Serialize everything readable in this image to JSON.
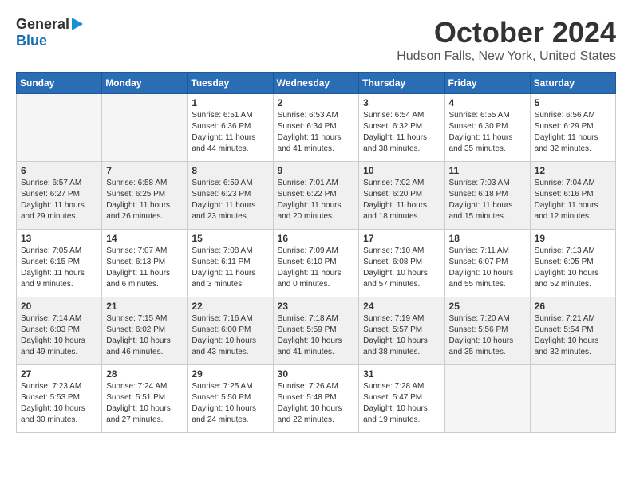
{
  "logo": {
    "general": "General",
    "blue": "Blue"
  },
  "title": "October 2024",
  "location": "Hudson Falls, New York, United States",
  "days_of_week": [
    "Sunday",
    "Monday",
    "Tuesday",
    "Wednesday",
    "Thursday",
    "Friday",
    "Saturday"
  ],
  "weeks": [
    [
      {
        "day": "",
        "sunrise": "",
        "sunset": "",
        "daylight": ""
      },
      {
        "day": "",
        "sunrise": "",
        "sunset": "",
        "daylight": ""
      },
      {
        "day": "1",
        "sunrise": "Sunrise: 6:51 AM",
        "sunset": "Sunset: 6:36 PM",
        "daylight": "Daylight: 11 hours and 44 minutes."
      },
      {
        "day": "2",
        "sunrise": "Sunrise: 6:53 AM",
        "sunset": "Sunset: 6:34 PM",
        "daylight": "Daylight: 11 hours and 41 minutes."
      },
      {
        "day": "3",
        "sunrise": "Sunrise: 6:54 AM",
        "sunset": "Sunset: 6:32 PM",
        "daylight": "Daylight: 11 hours and 38 minutes."
      },
      {
        "day": "4",
        "sunrise": "Sunrise: 6:55 AM",
        "sunset": "Sunset: 6:30 PM",
        "daylight": "Daylight: 11 hours and 35 minutes."
      },
      {
        "day": "5",
        "sunrise": "Sunrise: 6:56 AM",
        "sunset": "Sunset: 6:29 PM",
        "daylight": "Daylight: 11 hours and 32 minutes."
      }
    ],
    [
      {
        "day": "6",
        "sunrise": "Sunrise: 6:57 AM",
        "sunset": "Sunset: 6:27 PM",
        "daylight": "Daylight: 11 hours and 29 minutes."
      },
      {
        "day": "7",
        "sunrise": "Sunrise: 6:58 AM",
        "sunset": "Sunset: 6:25 PM",
        "daylight": "Daylight: 11 hours and 26 minutes."
      },
      {
        "day": "8",
        "sunrise": "Sunrise: 6:59 AM",
        "sunset": "Sunset: 6:23 PM",
        "daylight": "Daylight: 11 hours and 23 minutes."
      },
      {
        "day": "9",
        "sunrise": "Sunrise: 7:01 AM",
        "sunset": "Sunset: 6:22 PM",
        "daylight": "Daylight: 11 hours and 20 minutes."
      },
      {
        "day": "10",
        "sunrise": "Sunrise: 7:02 AM",
        "sunset": "Sunset: 6:20 PM",
        "daylight": "Daylight: 11 hours and 18 minutes."
      },
      {
        "day": "11",
        "sunrise": "Sunrise: 7:03 AM",
        "sunset": "Sunset: 6:18 PM",
        "daylight": "Daylight: 11 hours and 15 minutes."
      },
      {
        "day": "12",
        "sunrise": "Sunrise: 7:04 AM",
        "sunset": "Sunset: 6:16 PM",
        "daylight": "Daylight: 11 hours and 12 minutes."
      }
    ],
    [
      {
        "day": "13",
        "sunrise": "Sunrise: 7:05 AM",
        "sunset": "Sunset: 6:15 PM",
        "daylight": "Daylight: 11 hours and 9 minutes."
      },
      {
        "day": "14",
        "sunrise": "Sunrise: 7:07 AM",
        "sunset": "Sunset: 6:13 PM",
        "daylight": "Daylight: 11 hours and 6 minutes."
      },
      {
        "day": "15",
        "sunrise": "Sunrise: 7:08 AM",
        "sunset": "Sunset: 6:11 PM",
        "daylight": "Daylight: 11 hours and 3 minutes."
      },
      {
        "day": "16",
        "sunrise": "Sunrise: 7:09 AM",
        "sunset": "Sunset: 6:10 PM",
        "daylight": "Daylight: 11 hours and 0 minutes."
      },
      {
        "day": "17",
        "sunrise": "Sunrise: 7:10 AM",
        "sunset": "Sunset: 6:08 PM",
        "daylight": "Daylight: 10 hours and 57 minutes."
      },
      {
        "day": "18",
        "sunrise": "Sunrise: 7:11 AM",
        "sunset": "Sunset: 6:07 PM",
        "daylight": "Daylight: 10 hours and 55 minutes."
      },
      {
        "day": "19",
        "sunrise": "Sunrise: 7:13 AM",
        "sunset": "Sunset: 6:05 PM",
        "daylight": "Daylight: 10 hours and 52 minutes."
      }
    ],
    [
      {
        "day": "20",
        "sunrise": "Sunrise: 7:14 AM",
        "sunset": "Sunset: 6:03 PM",
        "daylight": "Daylight: 10 hours and 49 minutes."
      },
      {
        "day": "21",
        "sunrise": "Sunrise: 7:15 AM",
        "sunset": "Sunset: 6:02 PM",
        "daylight": "Daylight: 10 hours and 46 minutes."
      },
      {
        "day": "22",
        "sunrise": "Sunrise: 7:16 AM",
        "sunset": "Sunset: 6:00 PM",
        "daylight": "Daylight: 10 hours and 43 minutes."
      },
      {
        "day": "23",
        "sunrise": "Sunrise: 7:18 AM",
        "sunset": "Sunset: 5:59 PM",
        "daylight": "Daylight: 10 hours and 41 minutes."
      },
      {
        "day": "24",
        "sunrise": "Sunrise: 7:19 AM",
        "sunset": "Sunset: 5:57 PM",
        "daylight": "Daylight: 10 hours and 38 minutes."
      },
      {
        "day": "25",
        "sunrise": "Sunrise: 7:20 AM",
        "sunset": "Sunset: 5:56 PM",
        "daylight": "Daylight: 10 hours and 35 minutes."
      },
      {
        "day": "26",
        "sunrise": "Sunrise: 7:21 AM",
        "sunset": "Sunset: 5:54 PM",
        "daylight": "Daylight: 10 hours and 32 minutes."
      }
    ],
    [
      {
        "day": "27",
        "sunrise": "Sunrise: 7:23 AM",
        "sunset": "Sunset: 5:53 PM",
        "daylight": "Daylight: 10 hours and 30 minutes."
      },
      {
        "day": "28",
        "sunrise": "Sunrise: 7:24 AM",
        "sunset": "Sunset: 5:51 PM",
        "daylight": "Daylight: 10 hours and 27 minutes."
      },
      {
        "day": "29",
        "sunrise": "Sunrise: 7:25 AM",
        "sunset": "Sunset: 5:50 PM",
        "daylight": "Daylight: 10 hours and 24 minutes."
      },
      {
        "day": "30",
        "sunrise": "Sunrise: 7:26 AM",
        "sunset": "Sunset: 5:48 PM",
        "daylight": "Daylight: 10 hours and 22 minutes."
      },
      {
        "day": "31",
        "sunrise": "Sunrise: 7:28 AM",
        "sunset": "Sunset: 5:47 PM",
        "daylight": "Daylight: 10 hours and 19 minutes."
      },
      {
        "day": "",
        "sunrise": "",
        "sunset": "",
        "daylight": ""
      },
      {
        "day": "",
        "sunrise": "",
        "sunset": "",
        "daylight": ""
      }
    ]
  ]
}
